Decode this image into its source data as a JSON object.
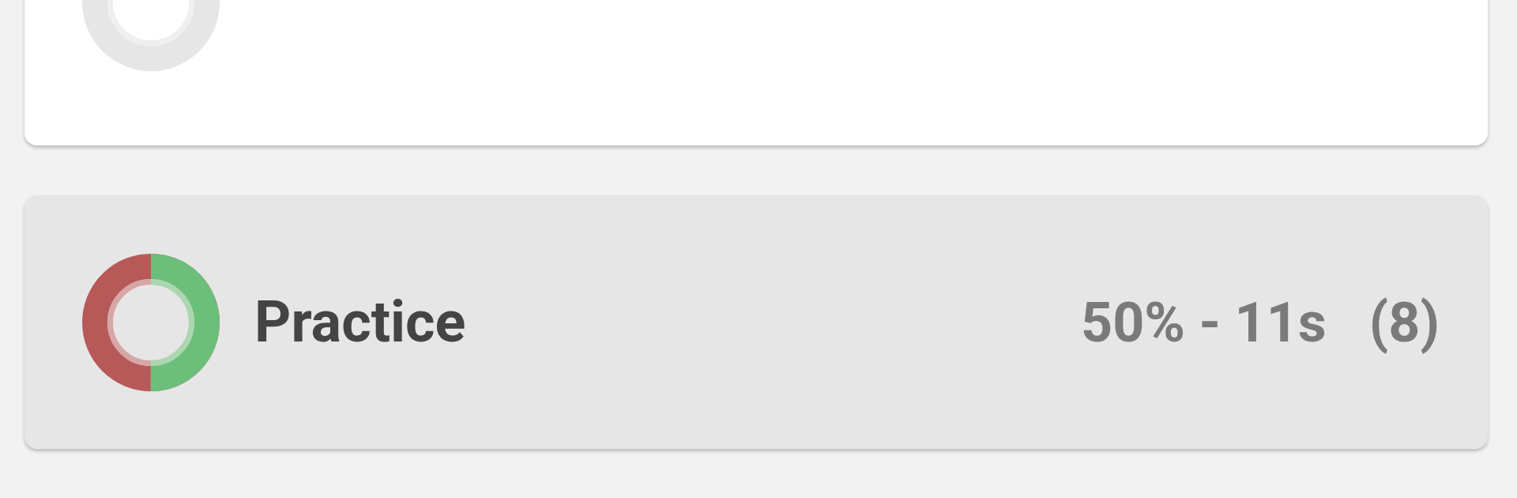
{
  "cards": [
    {
      "kind": "empty",
      "selected": false
    },
    {
      "kind": "scored",
      "selected": true,
      "title": "Practice",
      "stats": "50% - 11s",
      "count": "(8)"
    }
  ]
}
